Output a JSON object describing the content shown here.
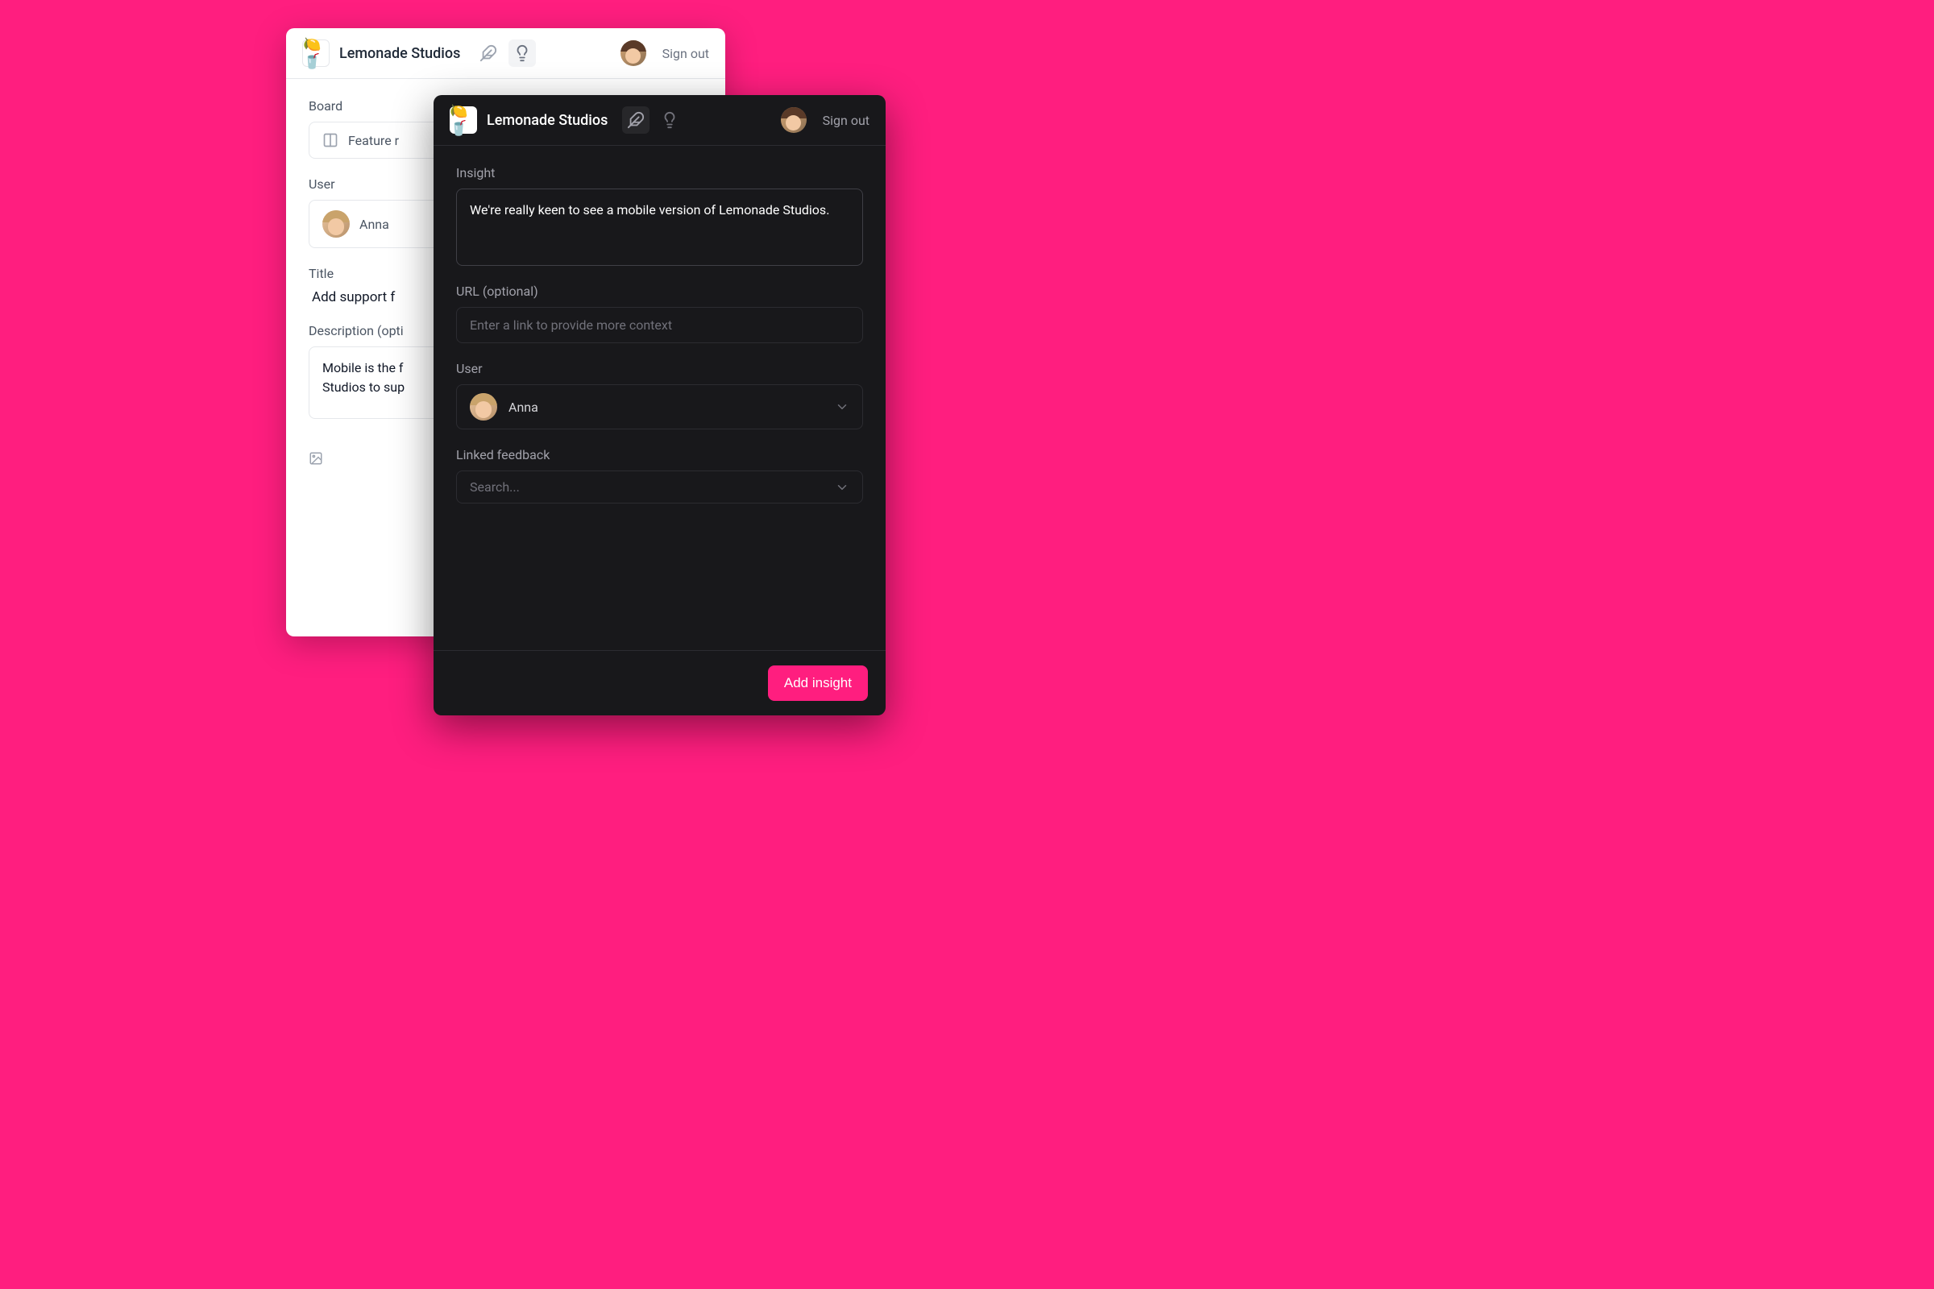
{
  "brand": "Lemonade Studios",
  "sign_out": "Sign out",
  "logo_emoji": "🍋🥤",
  "light": {
    "board_label": "Board",
    "board_value": "Feature r",
    "user_label": "User",
    "user_value": "Anna",
    "title_label": "Title",
    "title_value": "Add support f",
    "description_label": "Description (opti",
    "description_value": "Mobile is the f\nStudios to sup",
    "attach_label": ""
  },
  "dark": {
    "insight_label": "Insight",
    "insight_value": "We're really keen to see a mobile version of Lemonade Studios.",
    "url_label": "URL (optional)",
    "url_placeholder": "Enter a link to provide more context",
    "user_label": "User",
    "user_value": "Anna",
    "linked_label": "Linked feedback",
    "linked_placeholder": "Search...",
    "submit": "Add insight"
  }
}
